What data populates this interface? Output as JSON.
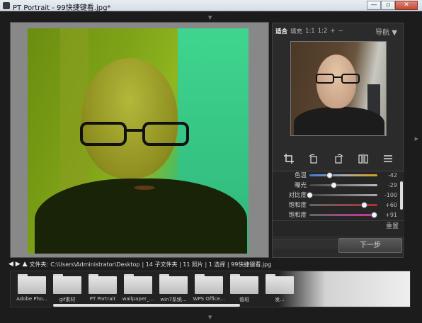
{
  "window": {
    "title": "PT Portrait - 99快捷键看.jpg*",
    "min": "—",
    "max": "▫",
    "close": "✕"
  },
  "zoom_bar": {
    "items": [
      "适合",
      "填充",
      "1:1",
      "1:2",
      "+",
      "−"
    ],
    "active": "适合"
  },
  "navigator_label": "导航 ▼",
  "tools": [
    "crop-icon",
    "rotate-left-icon",
    "rotate-right-icon",
    "flip-icon",
    "lines-icon"
  ],
  "adjustments": [
    {
      "label": "色温",
      "value": "-42",
      "level": 0.29
    },
    {
      "label": "曝光",
      "value": "-29",
      "level": 0.35
    },
    {
      "label": "对比度",
      "value": "-100",
      "level": 0.0
    },
    {
      "label": "饱和度",
      "value": "+60",
      "level": 0.8
    },
    {
      "label": "饱和度",
      "value": "+91",
      "level": 0.95
    }
  ],
  "reset_label": "重置",
  "next_button": "下一步",
  "pathbar": {
    "arrows": "◀ ▶ ▲",
    "prefix": "文件夹:",
    "path": "C:\\Users\\Administrator\\Desktop",
    "info": "| 14 子文件夹 | 11 照片 | 1 选择 | 99快捷键看.jpg"
  },
  "folders": [
    "Adobe Pho...",
    "gif素材",
    "PT Portrait",
    "wallpaper_...",
    "win7系统...",
    "WPS Office...",
    "值班",
    "发..."
  ]
}
